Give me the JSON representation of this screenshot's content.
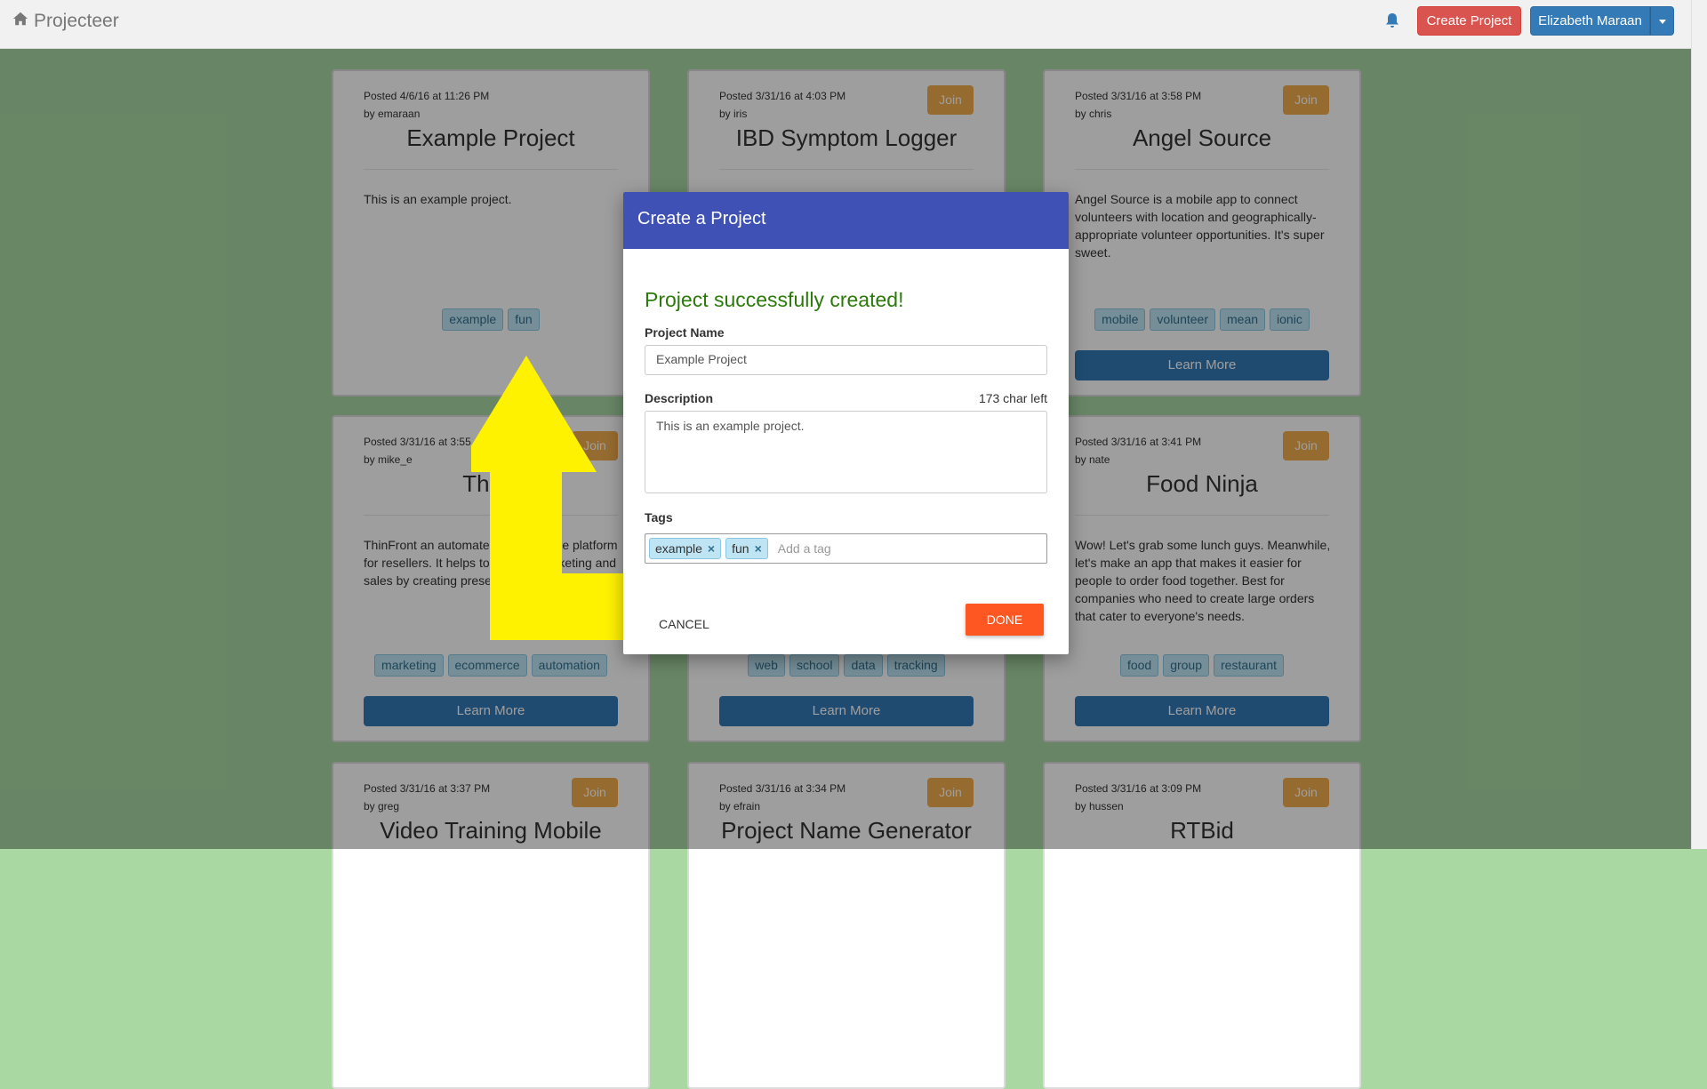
{
  "navbar": {
    "brand": "Projecteer",
    "create_label": "Create Project",
    "user_label": "Elizabeth Maraan"
  },
  "cards": [
    {
      "posted": "Posted 4/6/16 at 11:26 PM",
      "by": "by emaraan",
      "join": "",
      "title": "Example Project",
      "description": "This is an example project.",
      "tags": [
        "example",
        "fun"
      ],
      "learn": ""
    },
    {
      "posted": "Posted 3/31/16 at 4:03 PM",
      "by": "by iris",
      "join": "Join",
      "title": "IBD Symptom Logger",
      "description": "",
      "tags": [],
      "learn": ""
    },
    {
      "posted": "Posted 3/31/16 at 3:58 PM",
      "by": "by chris",
      "join": "Join",
      "title": "Angel Source",
      "description": "Angel Source is a mobile app to connect volunteers with location and geographically-appropriate volunteer opportunities. It's super sweet.",
      "tags": [
        "mobile",
        "volunteer",
        "mean",
        "ionic"
      ],
      "learn": "Learn More"
    },
    {
      "posted": "Posted 3/31/16 at 3:55",
      "by": "by mike_e",
      "join": "Join",
      "title": "Think",
      "description": "ThinFront an automated e-commerce platform for resellers. It helps to expand marketing and sales by creating presents and e-commerce",
      "tags": [
        "marketing",
        "ecommerce",
        "automation"
      ],
      "learn": "Learn More"
    },
    {
      "posted": "",
      "by": "",
      "join": "",
      "title": "",
      "description": "",
      "tags": [
        "web",
        "school",
        "data",
        "tracking"
      ],
      "learn": "Learn More"
    },
    {
      "posted": "Posted 3/31/16 at 3:41 PM",
      "by": "by nate",
      "join": "Join",
      "title": "Food Ninja",
      "description": "Wow! Let's grab some lunch guys. Meanwhile, let's make an app that makes it easier for people to order food together. Best for companies who need to create large orders that cater to everyone's needs.",
      "tags": [
        "food",
        "group",
        "restaurant"
      ],
      "learn": "Learn More"
    },
    {
      "posted": "Posted 3/31/16 at 3:37 PM",
      "by": "by greg",
      "join": "Join",
      "title": "Video Training Mobile",
      "description": "",
      "tags": [],
      "learn": ""
    },
    {
      "posted": "Posted 3/31/16 at 3:34 PM",
      "by": "by efrain",
      "join": "Join",
      "title": "Project Name Generator",
      "description": "",
      "tags": [],
      "learn": ""
    },
    {
      "posted": "Posted 3/31/16 at 3:09 PM",
      "by": "by hussen",
      "join": "Join",
      "title": "RTBid",
      "description": "",
      "tags": [],
      "learn": ""
    }
  ],
  "modal": {
    "title": "Create a Project",
    "success": "Project successfully created!",
    "name_label": "Project Name",
    "name_value": "Example Project",
    "desc_label": "Description",
    "char_left": "173 char left",
    "desc_value": "This is an example project.",
    "tags_label": "Tags",
    "tags": [
      "example",
      "fun"
    ],
    "tag_placeholder": "Add a tag",
    "cancel": "CANCEL",
    "done": "DONE"
  },
  "colors": {
    "background": "#a9d8a3",
    "primary": "#337ab7",
    "danger": "#d9534f",
    "warning": "#f0ad4e",
    "modal_header": "#3f51b5",
    "done": "#ff5722",
    "success_text": "#2b7a0b",
    "annotation_arrow": "#fff200"
  }
}
